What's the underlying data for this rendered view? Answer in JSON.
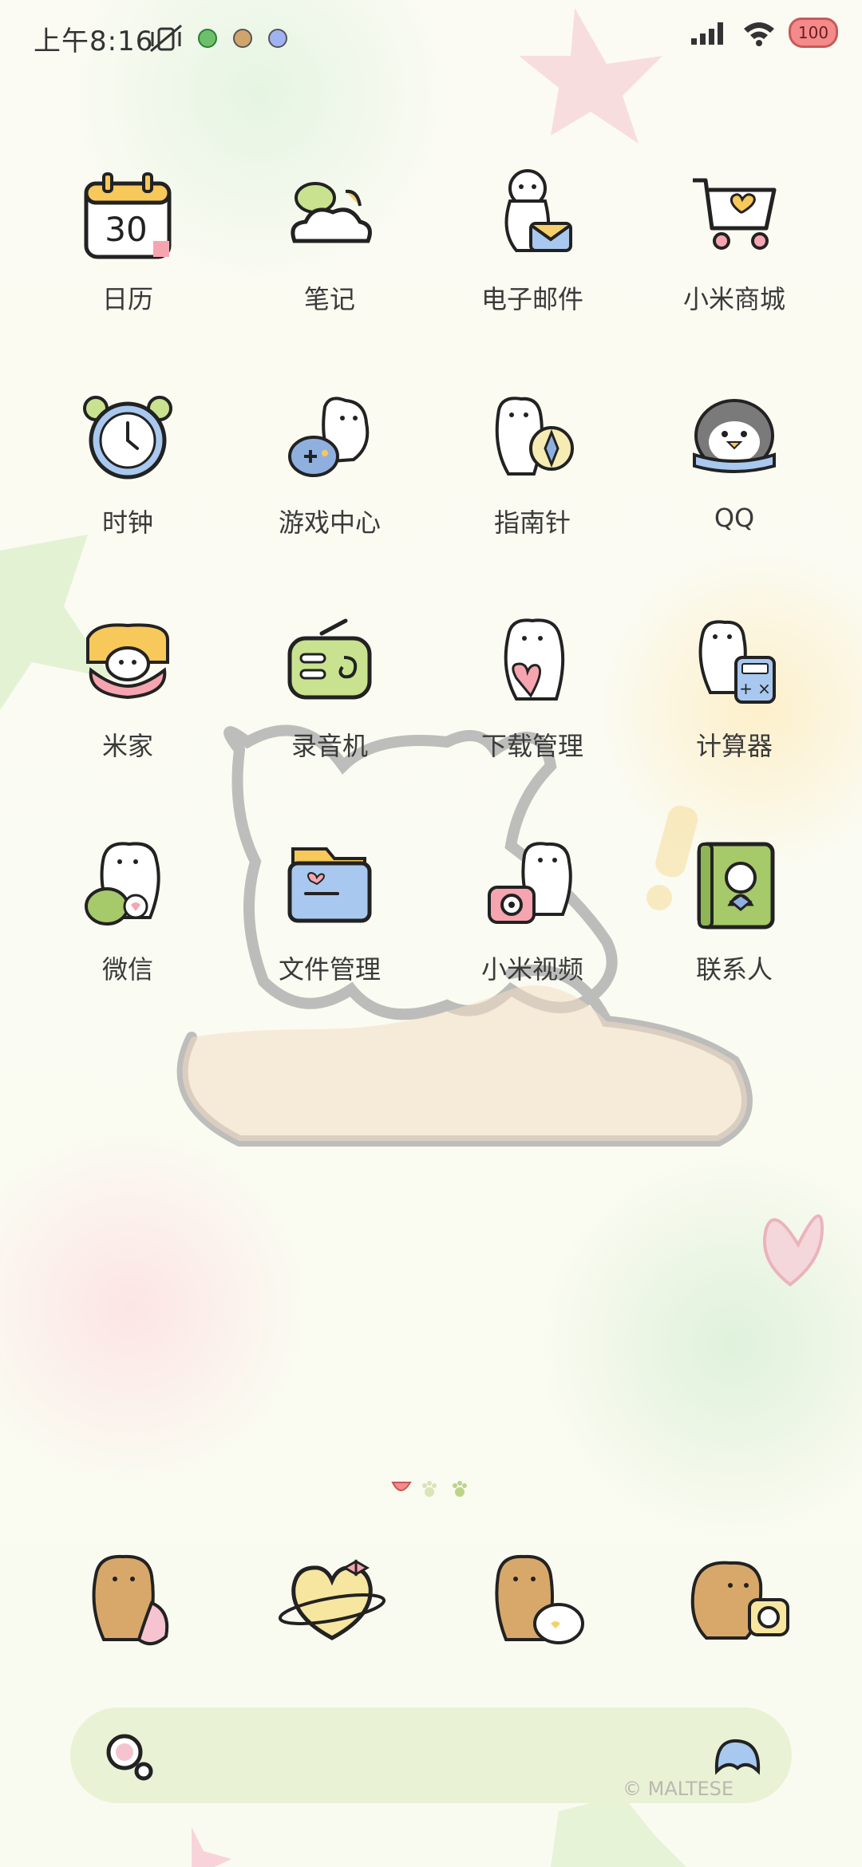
{
  "status_bar": {
    "time": "上午8:16",
    "battery_level": "100",
    "icons": [
      "vibrate-off-icon",
      "app-notification-icon",
      "app-notification-icon",
      "app-notification-icon",
      "signal-icon",
      "wifi-icon",
      "battery-icon"
    ]
  },
  "apps": [
    {
      "label": "日历",
      "icon": "calendar-icon",
      "date": "30"
    },
    {
      "label": "笔记",
      "icon": "notes-icon"
    },
    {
      "label": "电子邮件",
      "icon": "email-icon"
    },
    {
      "label": "小米商城",
      "icon": "shopping-cart-icon"
    },
    {
      "label": "时钟",
      "icon": "clock-icon"
    },
    {
      "label": "游戏中心",
      "icon": "game-center-icon"
    },
    {
      "label": "指南针",
      "icon": "compass-icon"
    },
    {
      "label": "QQ",
      "icon": "qq-penguin-icon"
    },
    {
      "label": "米家",
      "icon": "mijia-icon"
    },
    {
      "label": "录音机",
      "icon": "recorder-icon"
    },
    {
      "label": "下载管理",
      "icon": "download-manager-icon"
    },
    {
      "label": "计算器",
      "icon": "calculator-icon"
    },
    {
      "label": "微信",
      "icon": "wechat-icon"
    },
    {
      "label": "文件管理",
      "icon": "file-manager-icon"
    },
    {
      "label": "小米视频",
      "icon": "video-icon"
    },
    {
      "label": "联系人",
      "icon": "contacts-icon"
    }
  ],
  "page_indicator": {
    "pages": 3,
    "current": 1
  },
  "dock": [
    {
      "icon": "phone-icon"
    },
    {
      "icon": "heart-planet-icon"
    },
    {
      "icon": "message-icon"
    },
    {
      "icon": "camera-icon"
    }
  ],
  "search": {
    "icon_left": "search-icon",
    "icon_right": "assistant-icon"
  },
  "watermark": "© MALTESE",
  "colors": {
    "search_bar": "#e9f2d5",
    "battery": "#f48a8a",
    "label": "#3a3a3a"
  }
}
